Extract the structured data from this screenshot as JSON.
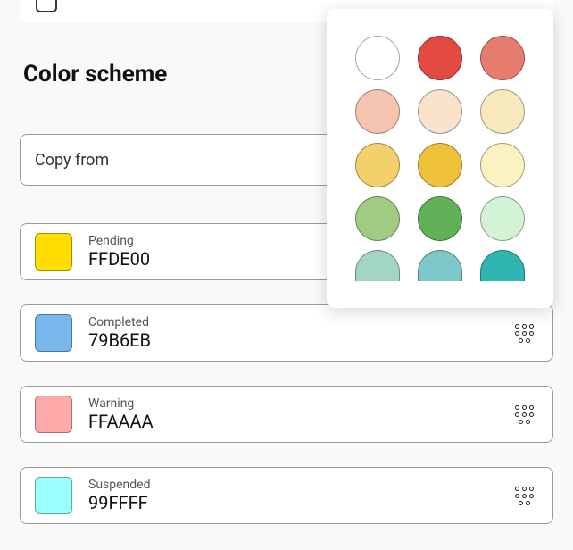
{
  "section_title": "Color scheme",
  "copy_from": {
    "label": "Copy from"
  },
  "items": [
    {
      "name": "Pending",
      "hex": "FFDE00",
      "swatch": "#FFDE00",
      "show_picker_btn": false
    },
    {
      "name": "Completed",
      "hex": "79B6EB",
      "swatch": "#79B6EB",
      "show_picker_btn": true
    },
    {
      "name": "Warning",
      "hex": "FFAAAA",
      "swatch": "#FFAAAA",
      "show_picker_btn": true
    },
    {
      "name": "Suspended",
      "hex": "99FFFF",
      "swatch": "#99FFFF",
      "show_picker_btn": true
    }
  ],
  "picker_colors": [
    "#FFFFFF",
    "#E24A42",
    "#E67C6E",
    "#F4C4B0",
    "#F8E2CC",
    "#F7E8BE",
    "#F3D06A",
    "#F0C13A",
    "#F8F3C0",
    "#9FCC82",
    "#62B158",
    "#D3F3D7",
    "#A3D6C2",
    "#7DC8C8",
    "#30B6B0"
  ]
}
